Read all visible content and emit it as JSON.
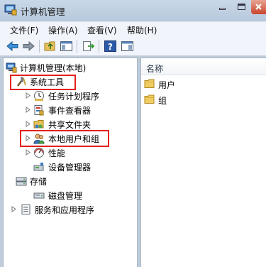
{
  "window": {
    "title": "计算机管理"
  },
  "menu": [
    {
      "label": "文件(F)"
    },
    {
      "label": "操作(A)"
    },
    {
      "label": "查看(V)"
    },
    {
      "label": "帮助(H)"
    }
  ],
  "tree": {
    "root": {
      "label": "计算机管理(本地)",
      "icon": "computer-management-icon"
    },
    "system_tools": {
      "label": "系统工具",
      "icon": "tools-icon",
      "expanded": true
    },
    "children": [
      {
        "label": "任务计划程序",
        "icon": "clock-icon"
      },
      {
        "label": "事件查看器",
        "icon": "event-viewer-icon"
      },
      {
        "label": "共享文件夹",
        "icon": "shared-folder-icon"
      },
      {
        "label": "本地用户和组",
        "icon": "users-icon"
      },
      {
        "label": "性能",
        "icon": "performance-icon"
      },
      {
        "label": "设备管理器",
        "icon": "device-manager-icon"
      }
    ],
    "storage": {
      "label": "存储",
      "icon": "storage-icon",
      "expanded": true
    },
    "disk_management": {
      "label": "磁盘管理",
      "icon": "disk-icon"
    },
    "services": {
      "label": "服务和应用程序",
      "icon": "services-icon"
    }
  },
  "list": {
    "column_header": "名称",
    "items": [
      {
        "label": "用户",
        "icon": "folder-icon"
      },
      {
        "label": "组",
        "icon": "folder-icon"
      }
    ]
  },
  "colors": {
    "highlight": "#e2211c",
    "chrome": "#bfcddb"
  }
}
